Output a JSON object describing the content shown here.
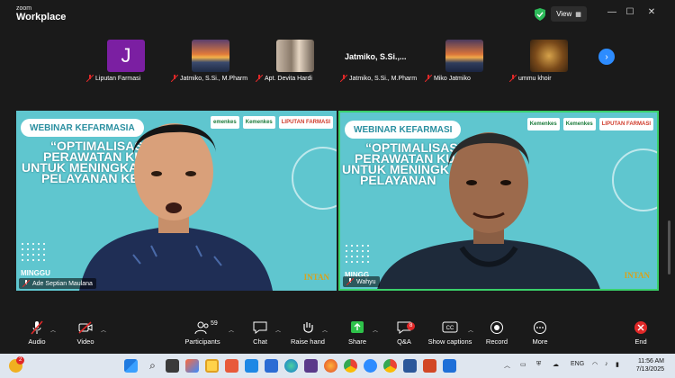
{
  "app": {
    "brand_small": "zoom",
    "brand_big": "Workplace",
    "view_label": "View"
  },
  "participants_strip": [
    {
      "name": "Liputan Farmasi",
      "avatar_letter": "J",
      "avatar_color": "#7b1fa2"
    },
    {
      "name": "Jatmiko, S.Si., M.Pharm",
      "avatar": "sunset"
    },
    {
      "name": "Apt. Devita Hardi",
      "avatar": "photo"
    },
    {
      "name": "Jatmiko, S.Si., M.Pharm",
      "display_name": "Jatmiko,  S.Si.,..."
    },
    {
      "name": "Miko Jatmiko",
      "avatar": "sunset"
    },
    {
      "name": "ummu khoir",
      "avatar": "ornament"
    }
  ],
  "videos": [
    {
      "name": "Ade Septian Maulana",
      "banner": "WEBINAR KEFARMASIA",
      "headline": [
        "“OPTIMALISASI E",
        "PERAWATAN KULIT",
        "UNTUK MENINGKATK",
        "PELAYANAN KES"
      ],
      "day": "MINGGU",
      "logos": [
        "emenkes",
        "Kemenkes",
        "LIPUTAN FARMASI"
      ],
      "sponsor": "INTAN"
    },
    {
      "name": "Wahyu",
      "banner": "WEBINAR KEFARMASI",
      "headline": [
        "“OPTIMALISASI",
        "PERAWATAN KUL",
        "UNTUK MENINGK",
        "PELAYANAN"
      ],
      "day": "MINGG",
      "logos": [
        "Kemenkes",
        "Kemenkes",
        "LIPUTAN FARMASI"
      ],
      "sponsor": "INTAN"
    }
  ],
  "toolbar": {
    "audio": "Audio",
    "video": "Video",
    "participants": "Participants",
    "participants_count": "59",
    "chat": "Chat",
    "raise_hand": "Raise hand",
    "share": "Share",
    "qa": "Q&A",
    "qa_badge": "8",
    "captions": "Show captions",
    "record": "Record",
    "more": "More",
    "end": "End"
  },
  "taskbar": {
    "notification_badge": "2",
    "lang": "ENG",
    "time": "11:56 AM",
    "date": "7/13/2025"
  },
  "colors": {
    "accent": "#2d8cff",
    "active_speaker": "#3ad16a",
    "end": "#e02828"
  }
}
